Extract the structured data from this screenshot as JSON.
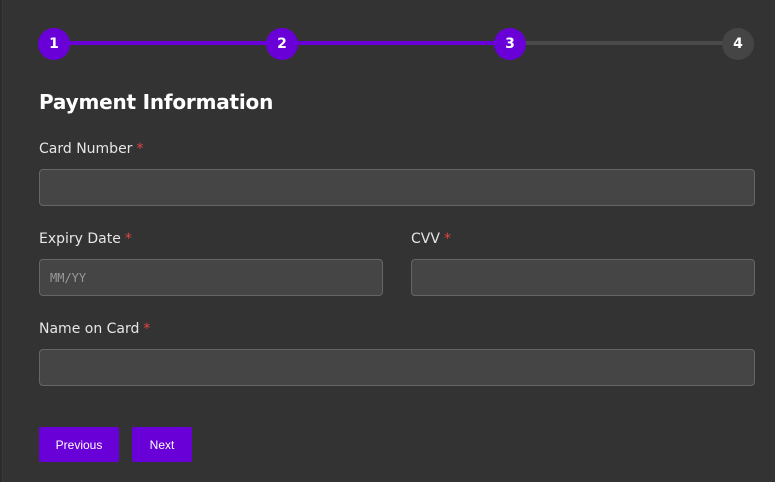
{
  "stepper": {
    "steps": [
      {
        "label": "1",
        "state": "done"
      },
      {
        "label": "2",
        "state": "done"
      },
      {
        "label": "3",
        "state": "done"
      },
      {
        "label": "4",
        "state": "todo"
      }
    ],
    "accent_color": "#6a00d8"
  },
  "form": {
    "title": "Payment Information",
    "required_marker": "*",
    "card_number": {
      "label": "Card Number",
      "value": "",
      "placeholder": ""
    },
    "expiry_date": {
      "label": "Expiry Date",
      "value": "",
      "placeholder": "MM/YY"
    },
    "cvv": {
      "label": "CVV",
      "value": "",
      "placeholder": ""
    },
    "name_on_card": {
      "label": "Name on Card",
      "value": "",
      "placeholder": ""
    }
  },
  "buttons": {
    "previous": "Previous",
    "next": "Next"
  }
}
